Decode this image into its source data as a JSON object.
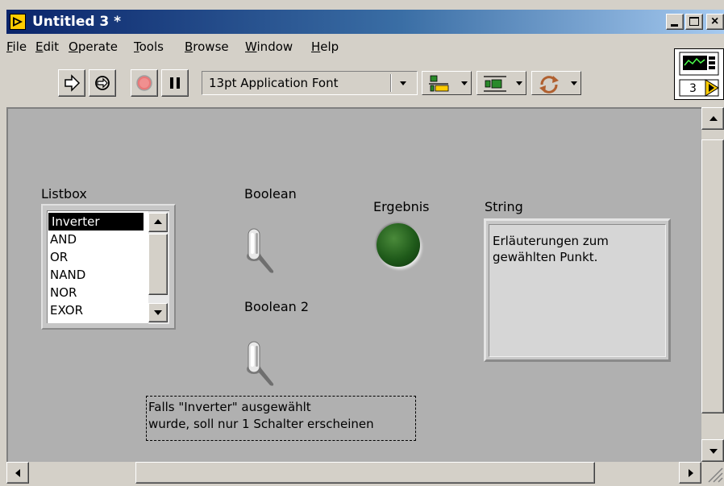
{
  "window": {
    "title": "Untitled 3 *",
    "icon_name": "labview-vi-icon"
  },
  "caption_buttons": {
    "minimize": "minimize-icon",
    "maximize": "maximize-icon",
    "close": "×"
  },
  "menu": [
    {
      "label": "File",
      "ul": "F",
      "rest": "ile"
    },
    {
      "label": "Edit",
      "ul": "E",
      "rest": "dit"
    },
    {
      "label": "Operate",
      "ul": "O",
      "rest": "perate"
    },
    {
      "label": "Tools",
      "ul": "T",
      "rest": "ools"
    },
    {
      "label": "Browse",
      "ul": "B",
      "rest": "rowse"
    },
    {
      "label": "Window",
      "ul": "W",
      "rest": "indow"
    },
    {
      "label": "Help",
      "ul": "H",
      "rest": "elp"
    }
  ],
  "toolbar": {
    "run_icon": "run-arrow-icon",
    "run_continuous_icon": "run-continuously-icon",
    "abort_icon": "abort-execution-icon",
    "pause_icon": "pause-icon",
    "font": "13pt Application Font",
    "align_icon": "align-objects-icon",
    "distribute_icon": "distribute-objects-icon",
    "reorder_icon": "reorder-icon"
  },
  "vi_icon": {
    "number": "3"
  },
  "panel": {
    "listbox": {
      "label": "Listbox",
      "items": [
        "Inverter",
        "AND",
        "OR",
        "NAND",
        "NOR",
        "EXOR"
      ],
      "selected": "Inverter"
    },
    "boolean1": {
      "label": "Boolean"
    },
    "boolean2": {
      "label": "Boolean 2"
    },
    "led": {
      "label": "Ergebnis",
      "color": "#1f5a1a"
    },
    "string": {
      "label": "String",
      "value": "Erläuterungen zum gewählten Punkt."
    },
    "note": {
      "line1": "Falls \"Inverter\" ausgewählt",
      "line2": "wurde, soll nur 1 Schalter erscheinen"
    }
  }
}
